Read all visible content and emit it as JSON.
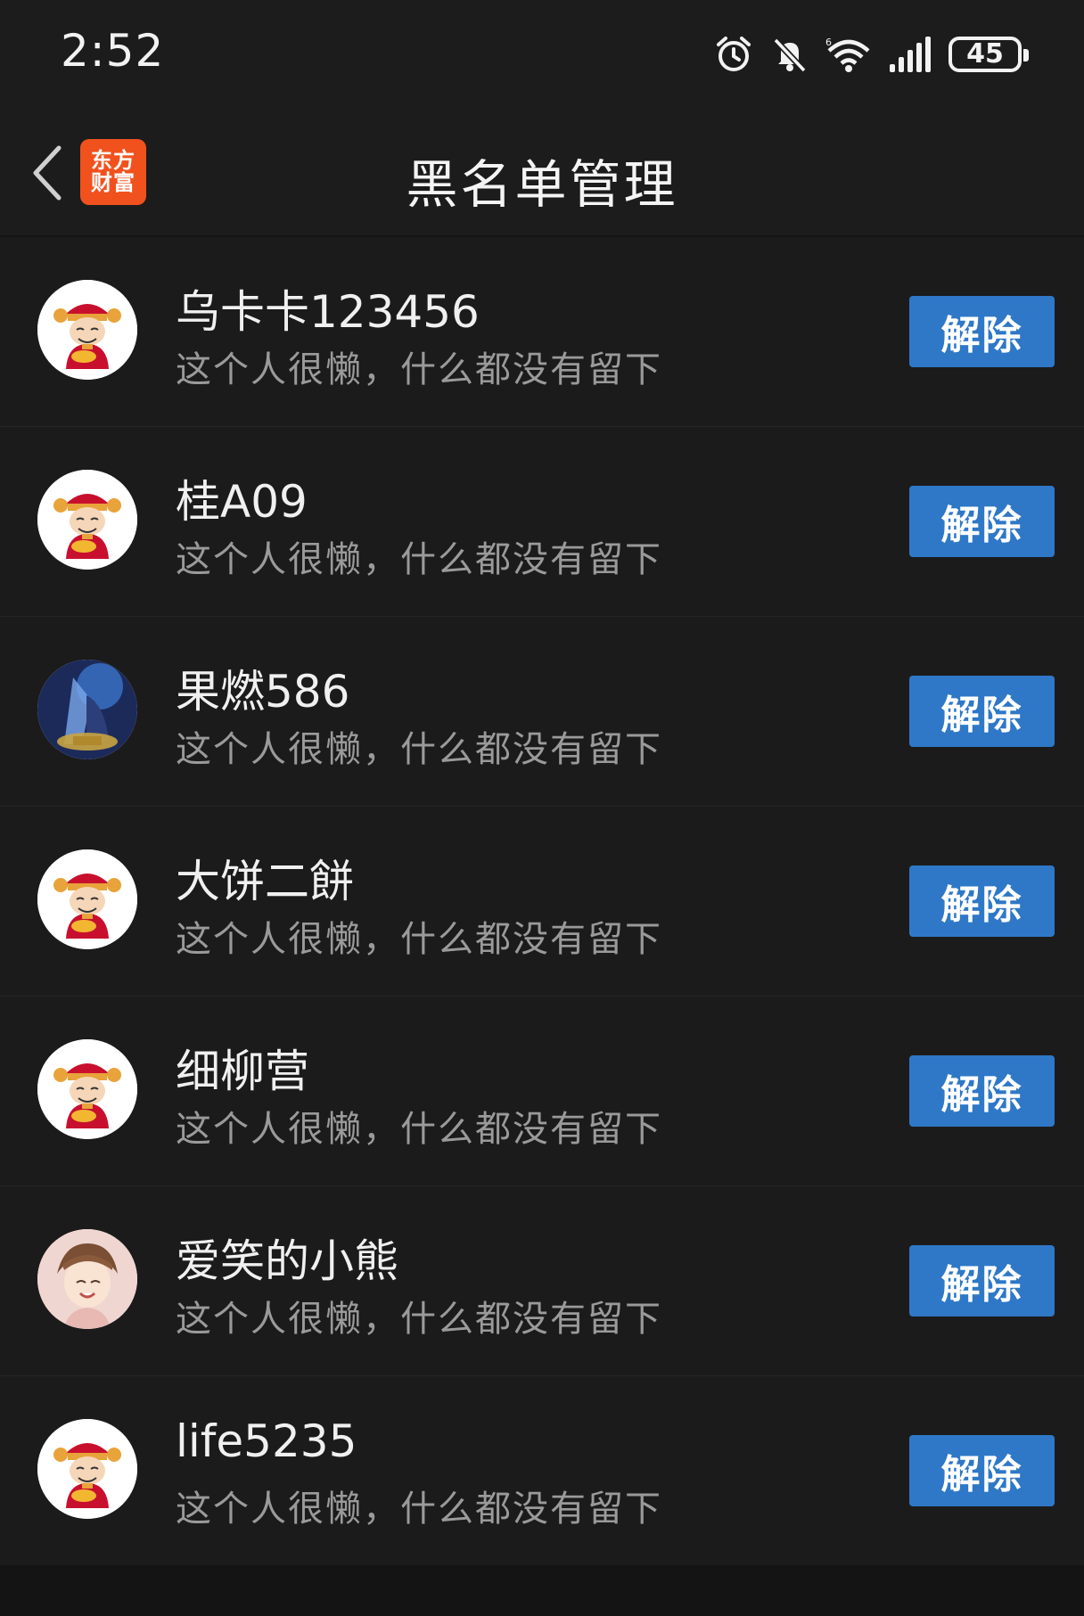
{
  "status_bar": {
    "time": "2:52",
    "battery": "45",
    "icons": [
      "alarm-icon",
      "bell-muted-icon",
      "wifi-icon",
      "signal-icon",
      "battery-icon"
    ]
  },
  "header": {
    "back_icon": "chevron-left-icon",
    "logo_line1": "东方",
    "logo_line2": "财富",
    "logo_color": "#f1521d",
    "title": "黑名单管理"
  },
  "theme": {
    "background": "#1b1b1c",
    "button_color": "#2e78c7"
  },
  "blacklist": [
    {
      "name": "乌卡卡123456",
      "desc": "这个人很懒，什么都没有留下",
      "action": "解除",
      "avatar": "fortune-god-avatar"
    },
    {
      "name": "桂A09",
      "desc": "这个人很懒，什么都没有留下",
      "action": "解除",
      "avatar": "fortune-god-avatar"
    },
    {
      "name": "果燃586",
      "desc": "这个人很懒，什么都没有留下",
      "action": "解除",
      "avatar": "game-hero-avatar"
    },
    {
      "name": "大饼二餅",
      "desc": "这个人很懒，什么都没有留下",
      "action": "解除",
      "avatar": "fortune-god-avatar"
    },
    {
      "name": "细柳营",
      "desc": "这个人很懒，什么都没有留下",
      "action": "解除",
      "avatar": "fortune-god-avatar"
    },
    {
      "name": "爱笑的小熊",
      "desc": "这个人很懒，什么都没有留下",
      "action": "解除",
      "avatar": "anime-boy-avatar"
    },
    {
      "name": "life5235",
      "desc": "这个人很懒，什么都没有留下",
      "action": "解除",
      "avatar": "fortune-god-avatar"
    }
  ]
}
